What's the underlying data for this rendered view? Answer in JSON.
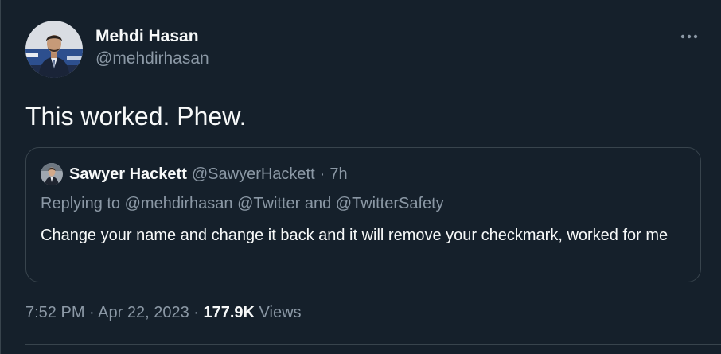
{
  "colors": {
    "background": "#15202b",
    "text_primary": "#f7f9f9",
    "text_secondary": "#8b98a5",
    "border": "#38444d"
  },
  "author": {
    "name": "Mehdi Hasan",
    "handle": "@mehdirhasan",
    "avatar_icon": "avatar-photo"
  },
  "more_icon": "more-horizontal-icon",
  "tweet": {
    "text": "This worked. Phew."
  },
  "quote": {
    "author_name": "Sawyer Hackett",
    "author_handle": "@SawyerHackett",
    "separator": "·",
    "time": "7h",
    "replying_to": "Replying to @mehdirhasan @Twitter and @TwitterSafety",
    "text": "Change your name and change it back and it will remove your checkmark, worked for me"
  },
  "meta": {
    "time": "7:52 PM",
    "sep1": " · ",
    "date": "Apr 22, 2023",
    "sep2": " · ",
    "views_count": "177.9K",
    "views_label": " Views"
  }
}
